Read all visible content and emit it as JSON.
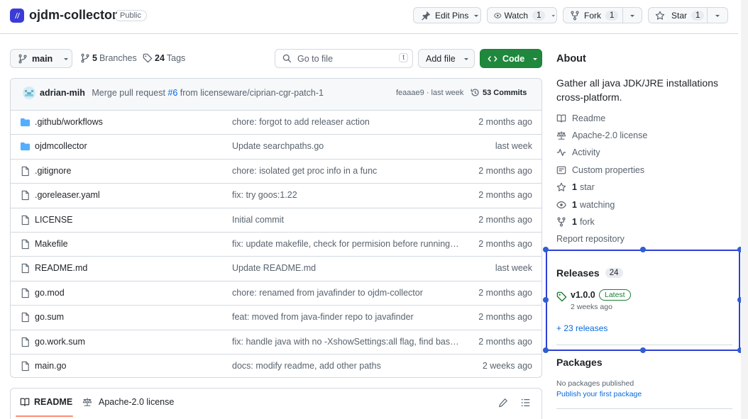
{
  "repo": {
    "name": "ojdm-collector",
    "visibility": "Public"
  },
  "header_actions": {
    "edit_pins": "Edit Pins",
    "watch_label": "Watch",
    "watch_count": "1",
    "fork_label": "Fork",
    "fork_count": "1",
    "star_label": "Star",
    "star_count": "1"
  },
  "toolbar": {
    "branch": "main",
    "branches_count": "5",
    "branches_label": "Branches",
    "tags_count": "24",
    "tags_label": "Tags",
    "search_placeholder": "Go to file",
    "search_shortcut": "t",
    "add_file": "Add file",
    "code": "Code"
  },
  "commit": {
    "author": "adrian-mih",
    "message_prefix": "Merge pull request ",
    "pr": "#6",
    "message_suffix": " from licenseware/ciprian-cgr-patch-1",
    "hash_time": "feaaae9 · last week",
    "commits": "53 Commits"
  },
  "files": [
    {
      "name": ".github/workflows",
      "type": "folder",
      "message": "chore: forgot to add releaser action",
      "date": "2 months ago"
    },
    {
      "name": "ojdmcollector",
      "type": "folder",
      "message": "Update searchpaths.go",
      "date": "last week"
    },
    {
      "name": ".gitignore",
      "type": "file",
      "message": "chore: isolated get proc info in a func",
      "date": "2 months ago"
    },
    {
      "name": ".goreleaser.yaml",
      "type": "file",
      "message": "fix: try goos:1.22",
      "date": "2 months ago"
    },
    {
      "name": "LICENSE",
      "type": "file",
      "message": "Initial commit",
      "date": "2 months ago"
    },
    {
      "name": "Makefile",
      "type": "file",
      "message": "fix: update makefile, check for permision before running i...",
      "date": "2 months ago"
    },
    {
      "name": "README.md",
      "type": "file",
      "message": "Update README.md",
      "date": "last week"
    },
    {
      "name": "go.mod",
      "type": "file",
      "message": "chore: renamed from javafinder to ojdm-collector",
      "date": "2 months ago"
    },
    {
      "name": "go.sum",
      "type": "file",
      "message": "feat: moved from java-finder repo to javafinder",
      "date": "2 months ago"
    },
    {
      "name": "go.work.sum",
      "type": "file",
      "message": "fix: handle java with no -XshowSettings:all flag, find base...",
      "date": "2 months ago"
    },
    {
      "name": "main.go",
      "type": "file",
      "message": "docs: modify readme, add other paths",
      "date": "2 weeks ago"
    }
  ],
  "readme_tabs": {
    "readme": "README",
    "license": "Apache-2.0 license"
  },
  "about": {
    "heading": "About",
    "description": "Gather all java JDK/JRE installations cross-platform.",
    "readme": "Readme",
    "license": "Apache-2.0 license",
    "activity": "Activity",
    "custom_properties": "Custom properties",
    "stars_count": "1",
    "stars_label": "star",
    "watching_count": "1",
    "watching_label": "watching",
    "forks_count": "1",
    "forks_label": "fork",
    "report": "Report repository"
  },
  "releases": {
    "heading": "Releases",
    "count": "24",
    "version": "v1.0.0",
    "latest_badge": "Latest",
    "date": "2 weeks ago",
    "more": "+ 23 releases"
  },
  "packages": {
    "heading": "Packages",
    "none": "No packages published",
    "publish": "Publish your first package"
  },
  "colors": {
    "accent": "#0969da",
    "code_button": "#1f883d",
    "folder": "#54aeff",
    "selection": "#2f3fd8"
  }
}
